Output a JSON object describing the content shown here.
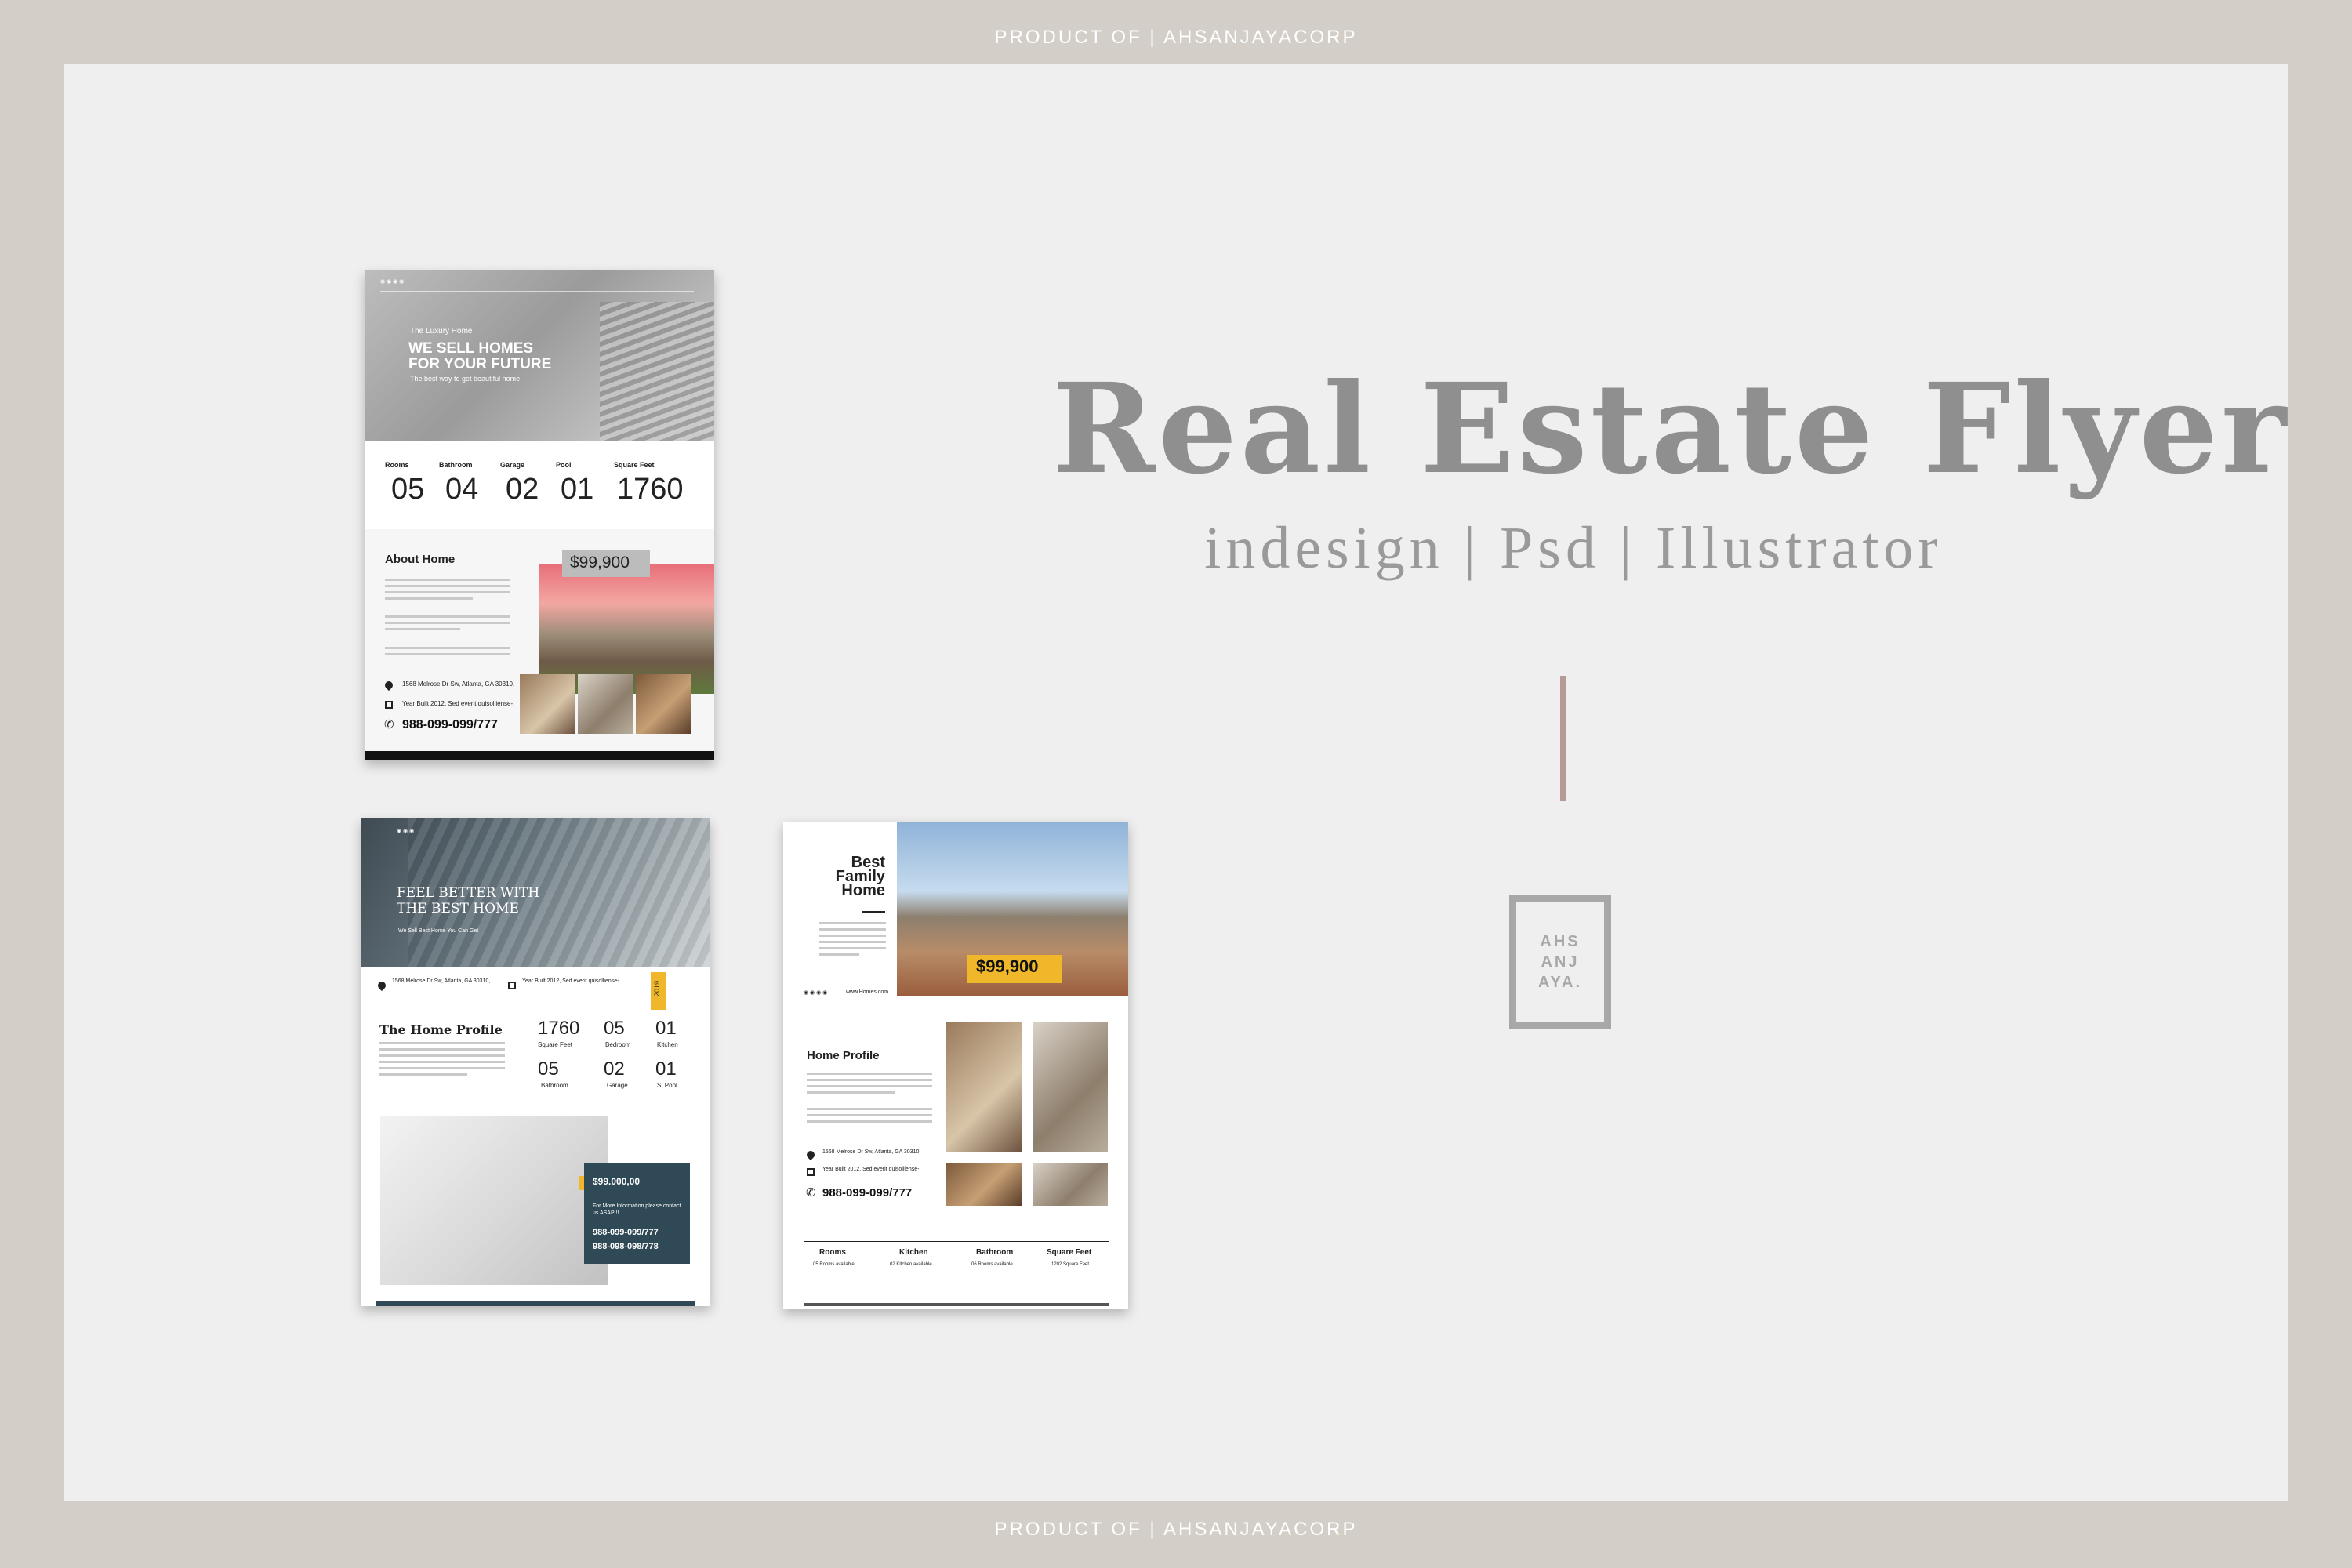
{
  "banner": {
    "top": "PRODUCT OF | AHSANJAYACORP",
    "bottom": "PRODUCT OF | AHSANJAYACORP"
  },
  "title": "Real Estate Flyer",
  "subtitle": "indesign | Psd | Illustrator",
  "logo": {
    "line1": "AHS",
    "line2": "ANJ",
    "line3": "AYA."
  },
  "flyer1": {
    "tagline": "The Luxury Home",
    "headline1": "WE SELL HOMES",
    "headline2": "FOR YOUR FUTURE",
    "subline": "The best way to get beautiful home",
    "stats": [
      {
        "label": "Rooms",
        "value": "05"
      },
      {
        "label": "Bathroom",
        "value": "04"
      },
      {
        "label": "Garage",
        "value": "02"
      },
      {
        "label": "Pool",
        "value": "01"
      },
      {
        "label": "Square Feet",
        "value": "1760"
      }
    ],
    "about_title": "About Home",
    "price": "$99,900",
    "address": "1568 Melrose Dr Sw, Atlanta, GA 30310,",
    "year": "Year Built 2012, Sed everit quisolliense-",
    "phone": "988-099-099/777"
  },
  "flyer2": {
    "headline1": "FEEL BETTER WITH",
    "headline2": "THE BEST HOME",
    "subline": "We Sell Best Home You Can Get",
    "address": "1568 Melrose Dr Sw, Atlanta, GA 30310,",
    "year_info": "Year Built 2012, Sed everit quisolliense-",
    "year_badge": "2019",
    "profile_title": "The Home Profile",
    "stats": [
      {
        "value": "1760",
        "label": "Square Feet"
      },
      {
        "value": "05",
        "label": "Bedroom"
      },
      {
        "value": "01",
        "label": "Kitchen"
      },
      {
        "value": "05",
        "label": "Bathroom"
      },
      {
        "value": "02",
        "label": "Garage"
      },
      {
        "value": "01",
        "label": "S. Pool"
      }
    ],
    "price": "$99.000,00",
    "contact_note": "For More Information please contact us ASAP!!!",
    "phone1": "988-099-099/777",
    "phone2": "988-098-098/778"
  },
  "flyer3": {
    "title1": "Best",
    "title2": "Family",
    "title3": "Home",
    "price": "$99,900",
    "website": "www.Homes.com",
    "profile_title": "Home Profile",
    "address": "1568 Melrose Dr Sw, Atlanta, GA 30310,",
    "year": "Year Built 2012, Sed everit quisolliense-",
    "phone": "988-099-099/777",
    "features": [
      {
        "title": "Rooms",
        "detail": "05 Rooms available"
      },
      {
        "title": "Kitchen",
        "detail": "02 Kitchen available"
      },
      {
        "title": "Bathroom",
        "detail": "06 Rooms available"
      },
      {
        "title": "Square Feet",
        "detail": "1202 Square Feet"
      }
    ]
  },
  "colors": {
    "frame": "#d3cfc8",
    "canvas": "#efefef",
    "title_gray": "#8f8f8f",
    "divider": "#b59a98",
    "accent_yellow": "#f0b72a",
    "panel_navy": "#2f4a56"
  }
}
